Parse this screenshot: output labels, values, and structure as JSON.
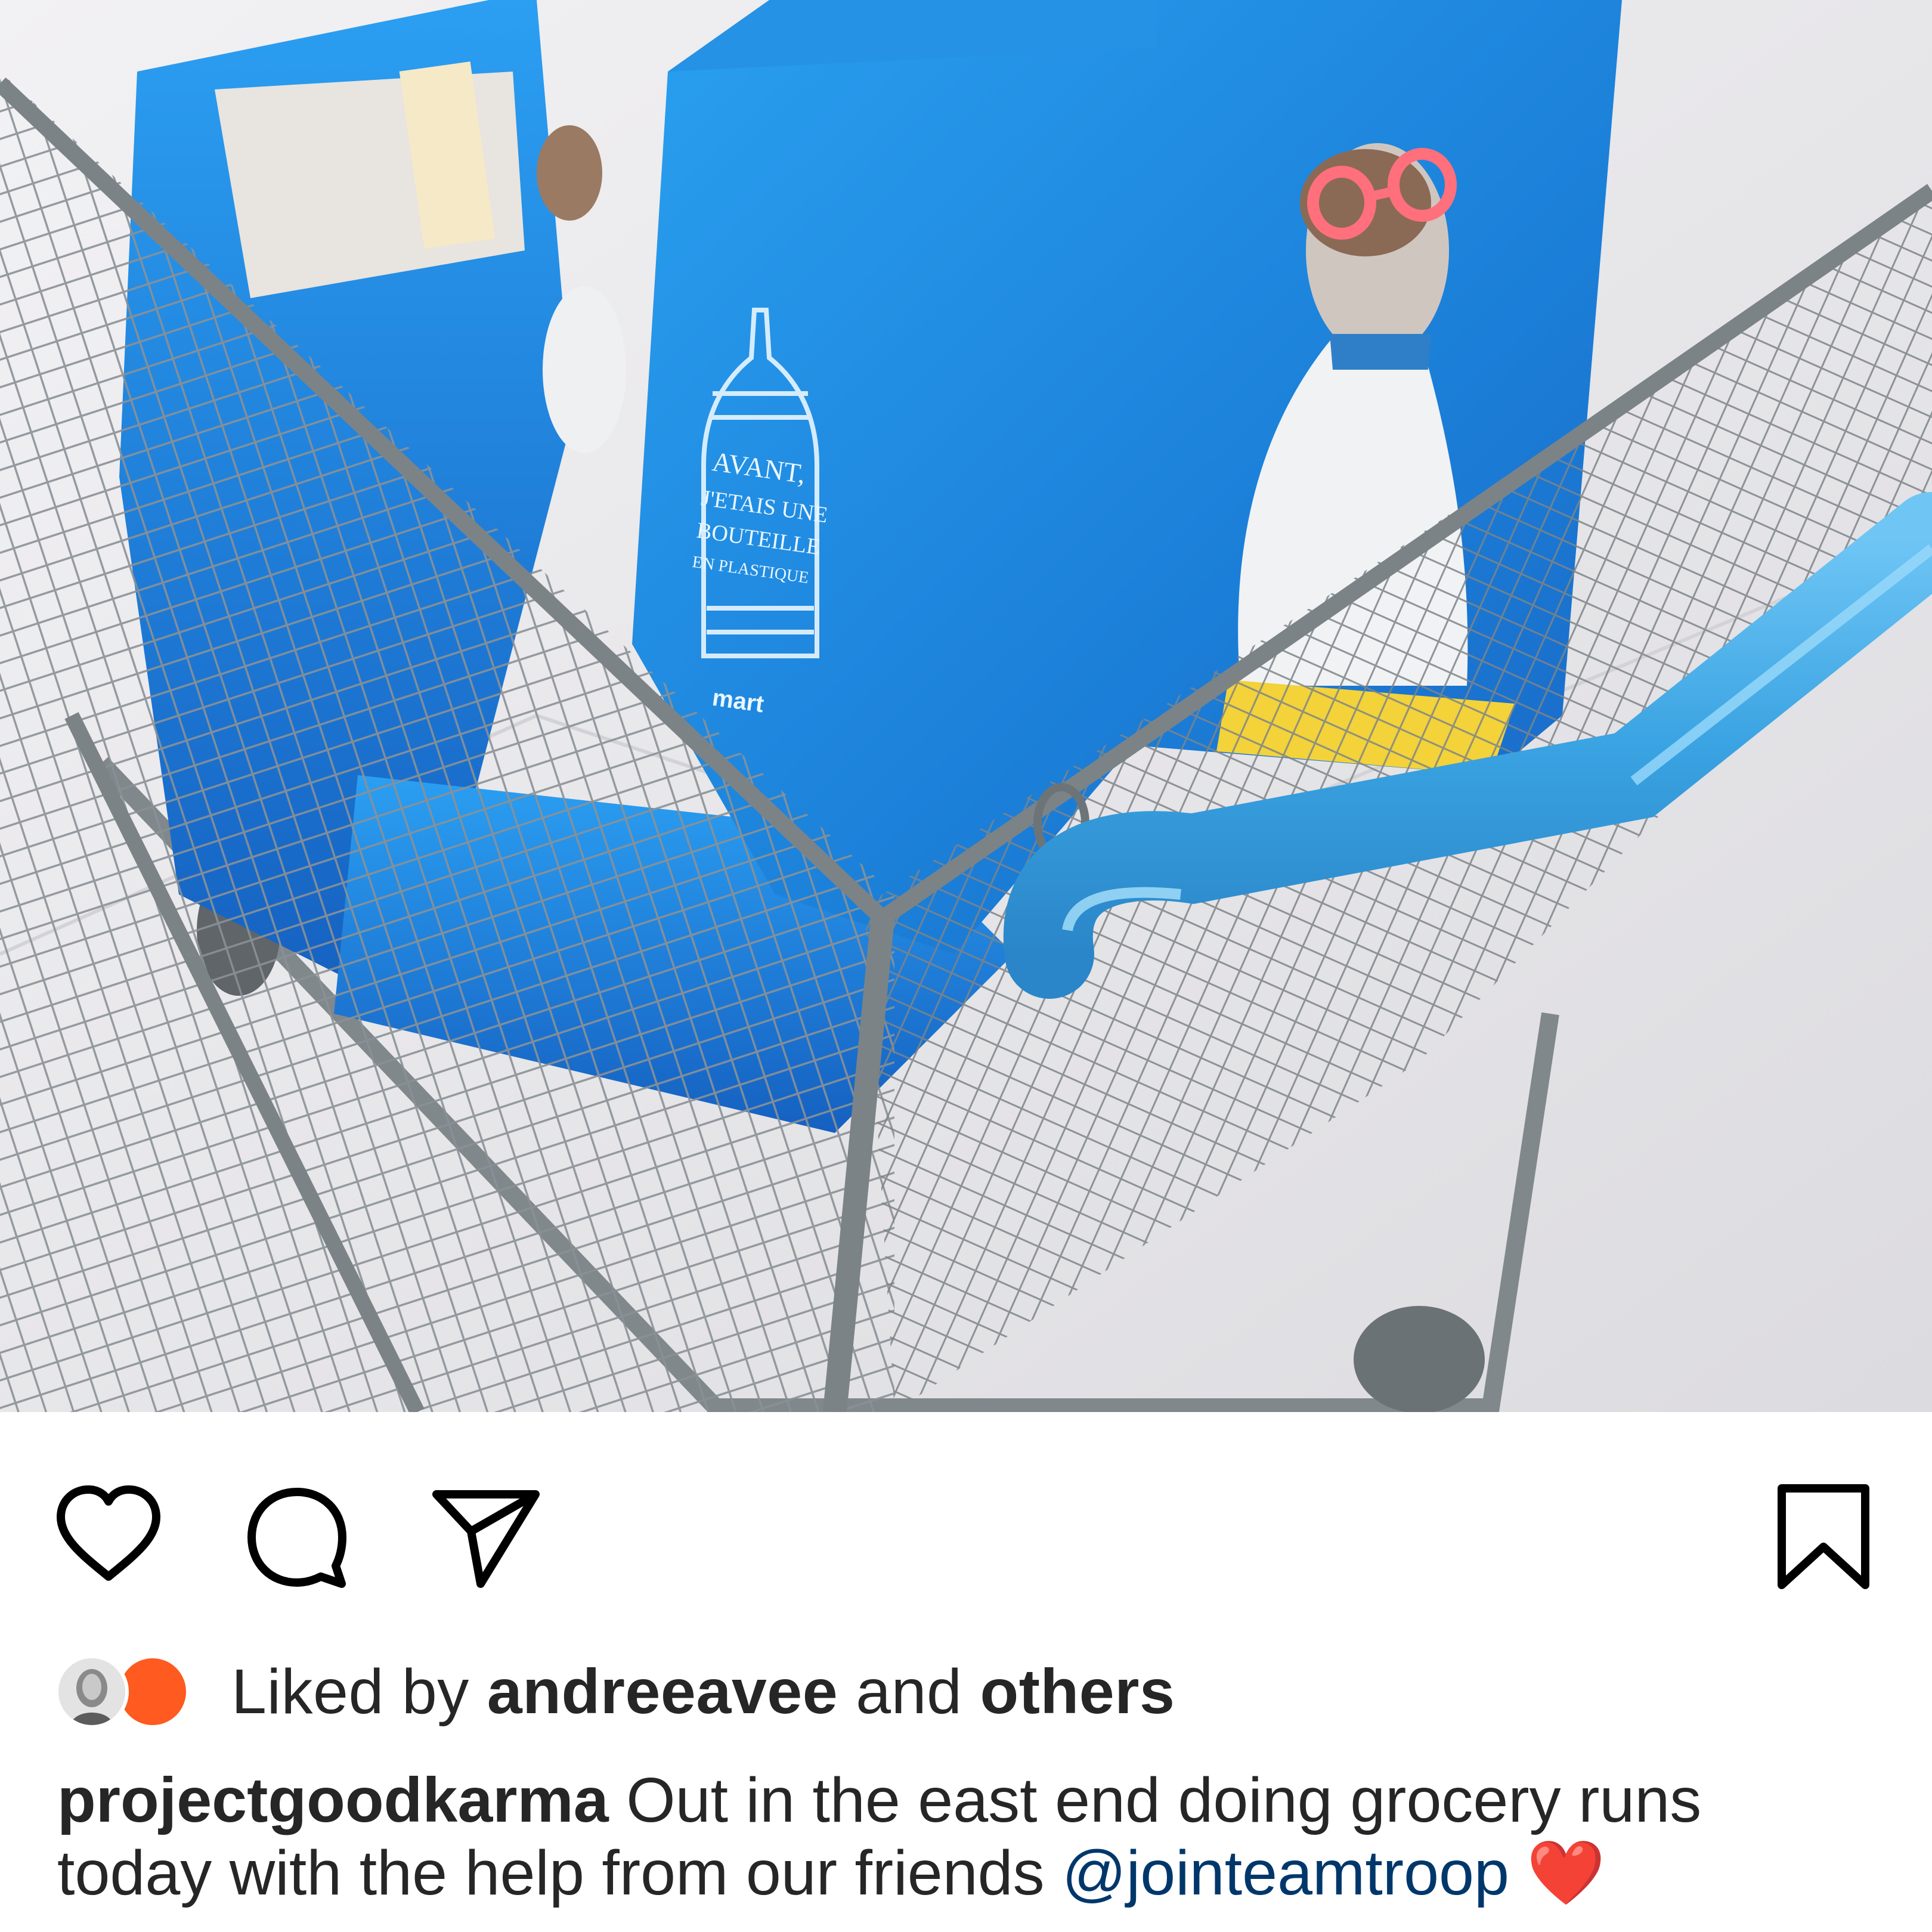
{
  "post": {
    "image_alt": "Shopping cart with blue reusable bags",
    "bag_text": {
      "line1": "AVANT,",
      "line2": "J'ETAIS UNE",
      "line3": "BOUTEILLE",
      "line4": "EN PLASTIQUE",
      "brand": "mart"
    },
    "actions": {
      "like_icon": "heart-icon",
      "comment_icon": "comment-icon",
      "share_icon": "paper-plane-icon",
      "save_icon": "bookmark-icon"
    },
    "likes": {
      "prefix": "Liked by ",
      "user": "andreeavee",
      "middle": " and ",
      "others": "others"
    },
    "caption": {
      "username": "projectgoodkarma",
      "text_line1": " Out in the east end doing grocery runs",
      "text_line2": "today with the help from our friends ",
      "mention": "@jointeamtroop",
      "emoji": " ❤️"
    },
    "colors": {
      "bag_blue": "#1d8de0",
      "handle_blue": "#3da8e6",
      "text": "#262626",
      "mention": "#00376b",
      "avatar_orange": "#ff5a1f"
    }
  }
}
